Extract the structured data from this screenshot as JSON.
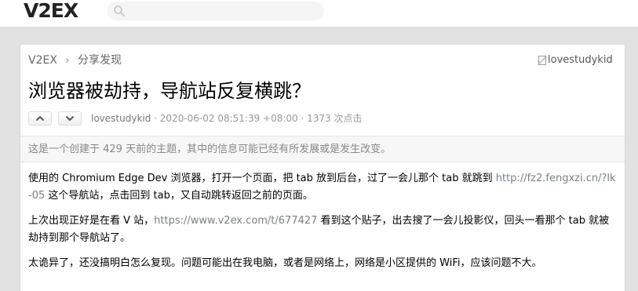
{
  "header": {
    "logo": "V2EX",
    "search_placeholder": ""
  },
  "breadcrumb": {
    "home": "V2EX",
    "separator": "›",
    "node": "分享发现"
  },
  "avatar_alt": "lovestudykid",
  "topic": {
    "title": "浏览器被劫持，导航站反复横跳？",
    "author": "lovestudykid",
    "meta_rest": " · 2020-06-02 08:51:39 +08:00 · 1373 次点击"
  },
  "notice": "这是一个创建于 429 天前的主题，其中的信息可能已经有所发展或是发生改变。",
  "content": {
    "p1_a": "使用的 Chromium Edge Dev 浏览器，打开一个页面，把 tab 放到后台，过了一会儿那个 tab 就跳到 ",
    "p1_link": "http://fz2.fengxzi.cn/?lk-05",
    "p1_b": " 这个导航站，点击回到 tab，又自动跳转返回之前的页面。",
    "p2_a": "上次出现正好是在看 V 站，",
    "p2_link": "https://www.v2ex.com/t/677427",
    "p2_b": " 看到这个贴子，出去搜了一会儿投影仪，回头一看那个 tab 就被劫持到那个导航站了。",
    "p3": "太诡异了，还没搞明白怎么复现。问题可能出在我电脑，或者是网络上，网络是小区提供的 WiFi，应该问题不大。"
  },
  "colors": {
    "background": "#e2e2e2",
    "link": "#778087",
    "muted": "#999999"
  }
}
